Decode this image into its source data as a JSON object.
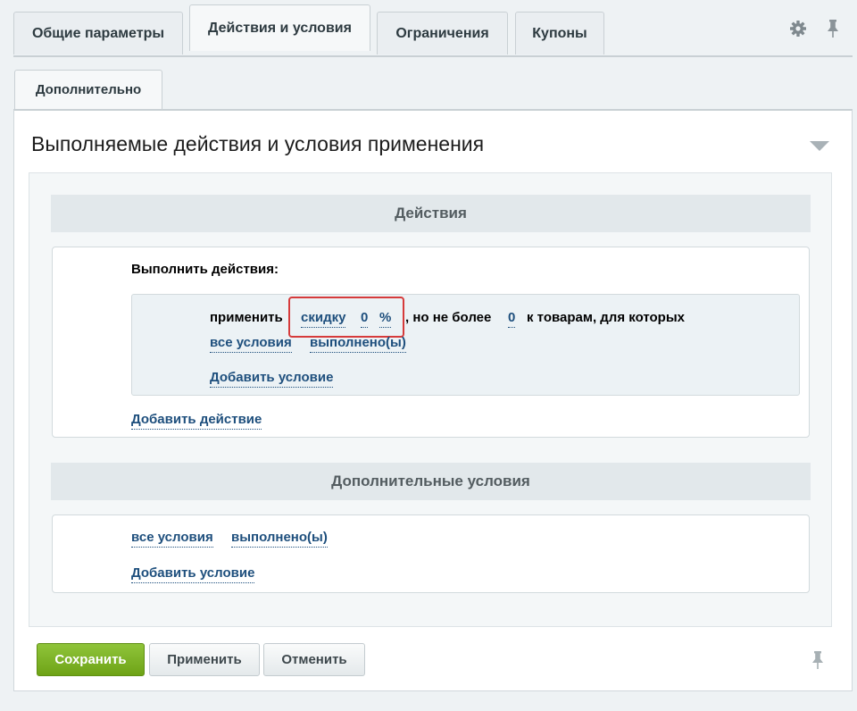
{
  "tabs": [
    {
      "label": "Общие параметры"
    },
    {
      "label": "Действия и условия"
    },
    {
      "label": "Ограничения"
    },
    {
      "label": "Купоны"
    }
  ],
  "tab_row2": {
    "label": "Дополнительно"
  },
  "panel": {
    "title": "Выполняемые действия и условия применения"
  },
  "actions": {
    "section_title": "Действия",
    "label": "Выполнить действия:",
    "rule": {
      "prefix": "применить",
      "type": "скидку",
      "value": "0",
      "unit": "%",
      "mid": ", но не более",
      "max": "0",
      "suffix": "к товарам, для которых",
      "cond_all": "все условия",
      "cond_state": "выполнено(ы)",
      "add_condition": "Добавить условие"
    },
    "add_action": "Добавить действие"
  },
  "extra": {
    "section_title": "Дополнительные условия",
    "cond_all": "все условия",
    "cond_state": "выполнено(ы)",
    "add_condition": "Добавить условие"
  },
  "buttons": {
    "save": "Сохранить",
    "apply": "Применить",
    "cancel": "Отменить"
  },
  "colors": {
    "link": "#1e4f7d",
    "save_button": "#7bb222",
    "highlight": "#d63b3b"
  }
}
